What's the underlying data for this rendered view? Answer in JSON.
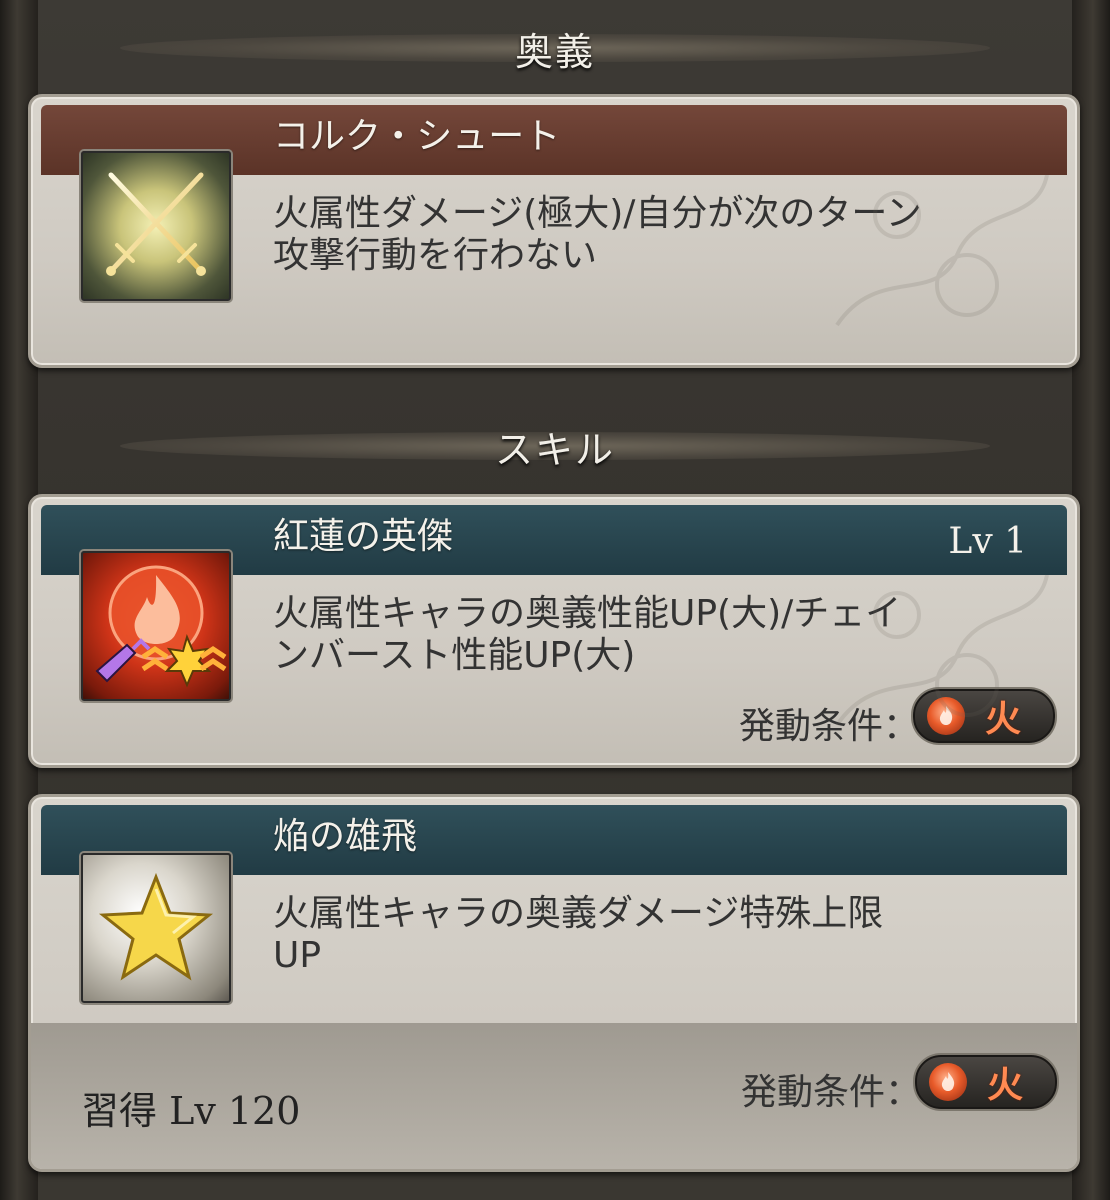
{
  "sections": {
    "ougi_header": "奥義",
    "skill_header": "スキル"
  },
  "ougi": {
    "name": "コルク・シュート",
    "description_line1": "火属性ダメージ(極大)/自分が次のターン",
    "description_line2": "攻撃行動を行わない",
    "icon": "crossed-swords-icon"
  },
  "skills": [
    {
      "name": "紅蓮の英傑",
      "level": "Lv 1",
      "description_line1": "火属性キャラの奥義性能UP(大)/チェイ",
      "description_line2": "ンバースト性能UP(大)",
      "condition_label": "発動条件：",
      "condition_element": "火",
      "icon": "fire-orb-icon"
    },
    {
      "name": "焔の雄飛",
      "description_line1": "火属性キャラの奥義ダメージ特殊上限",
      "description_line2": "UP",
      "acquire": "習得 Lv 120",
      "condition_label": "発動条件：",
      "condition_element": "火",
      "icon": "star-icon"
    }
  ],
  "colors": {
    "ougi_title_bar": "#5b3327",
    "skill_title_bar": "#213b44",
    "fire_text": "#ff8a52"
  }
}
